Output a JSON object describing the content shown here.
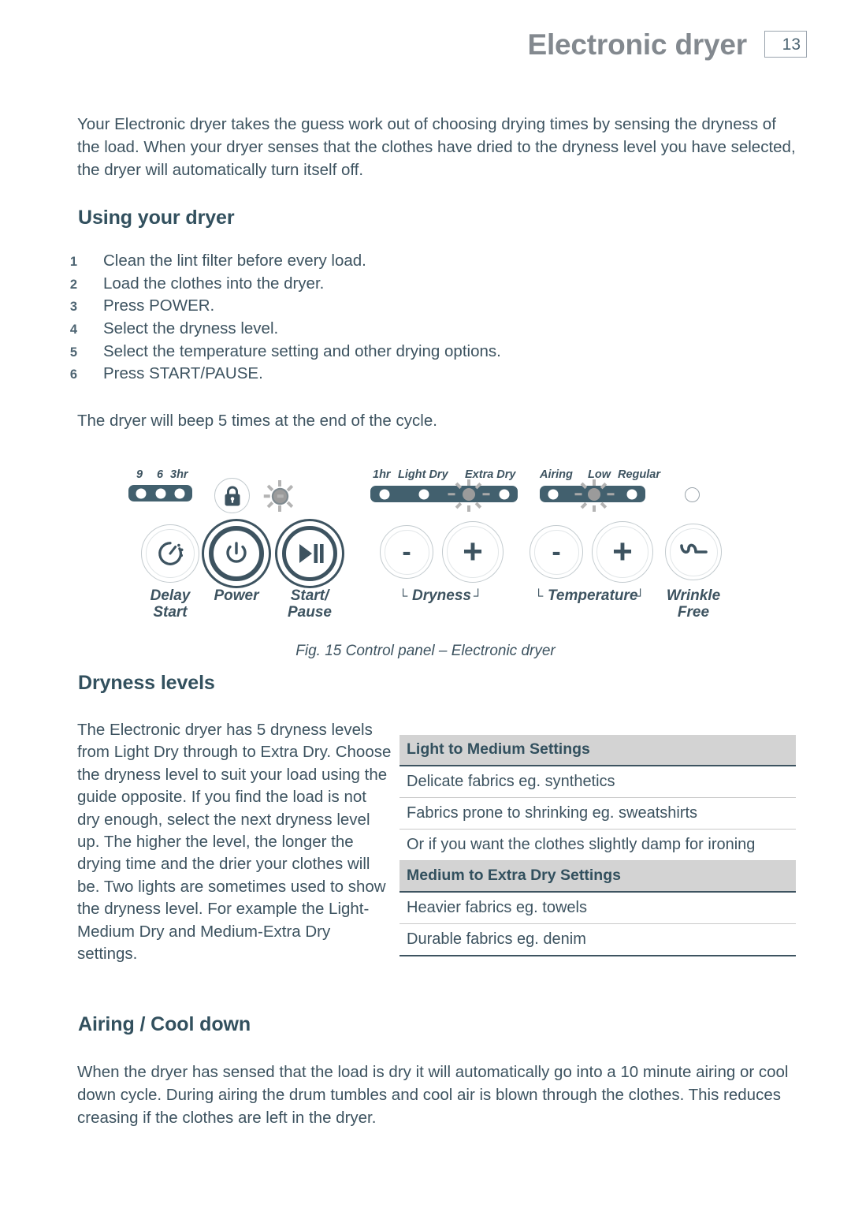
{
  "header": {
    "title": "Electronic dryer",
    "page_number": "13"
  },
  "intro": {
    "paragraph": "Your Electronic dryer takes the guess work out of choosing drying times by sensing the dryness of the load. When your dryer senses that the clothes have dried to the dryness level you have selected, the dryer will automatically turn itself off."
  },
  "using_your_dryer": {
    "heading": "Using your dryer",
    "steps": [
      {
        "num": "1",
        "text": "Clean the lint filter before every load."
      },
      {
        "num": "2",
        "text": "Load the clothes into the dryer."
      },
      {
        "num": "3",
        "text": "Press POWER."
      },
      {
        "num": "4",
        "text": "Select the dryness level."
      },
      {
        "num": "5",
        "text": "Select the temperature setting and other drying options."
      },
      {
        "num": "6",
        "text": "Press START/PAUSE."
      }
    ],
    "note": "The dryer will beep 5 times at the end of the cycle."
  },
  "control_panel": {
    "caption": "Fig. 15 Control panel – Electronic dryer",
    "delay_leds": {
      "labels": [
        "9",
        "6",
        "3hr"
      ]
    },
    "buttons": {
      "delay_start": "Delay\nStart",
      "power": "Power",
      "start_pause": "Start/\nPause",
      "wrinkle_free": "Wrinkle\nFree"
    },
    "dryness": {
      "group_label": "Dryness",
      "labels": [
        "1hr",
        "Light Dry",
        "Extra Dry"
      ],
      "minus": "-",
      "plus": "+"
    },
    "temperature": {
      "group_label": "Temperature",
      "labels": [
        "Airing",
        "Low",
        "Regular"
      ],
      "minus": "-",
      "plus": "+"
    },
    "bracket_left": "└",
    "bracket_right": "┘"
  },
  "dryness_levels": {
    "heading": "Dryness levels",
    "paragraph": "The Electronic dryer has 5 dryness levels from Light Dry through to Extra Dry. Choose the dryness level to suit your load using the guide opposite. If you find the load is not dry enough, select the next dryness level up. The higher the level, the longer the drying time and the drier your clothes will be. Two lights are sometimes used to show the dryness level. For example the Light-Medium Dry and Medium-Extra Dry settings."
  },
  "settings_table": {
    "sections": [
      {
        "header": "Light to Medium Settings",
        "rows": [
          "Delicate fabrics eg. synthetics",
          "Fabrics prone to shrinking eg. sweatshirts",
          "Or if you want the clothes slightly damp for ironing"
        ]
      },
      {
        "header": "Medium to Extra Dry Settings",
        "rows": [
          "Heavier fabrics eg. towels",
          "Durable fabrics eg. denim"
        ]
      }
    ]
  },
  "airing": {
    "heading": "Airing / Cool down",
    "paragraph": "When the dryer has sensed that the load is dry it will automatically go into a 10 minute airing or cool down cycle. During airing the drum tumbles and cool air is blown through the clothes. This reduces creasing if the clothes are left in the dryer."
  },
  "colors": {
    "ink": "#3d5360",
    "header_gray": "#83898f",
    "panel_dark": "#42606e",
    "table_header_bg": "#d3d3d3"
  }
}
